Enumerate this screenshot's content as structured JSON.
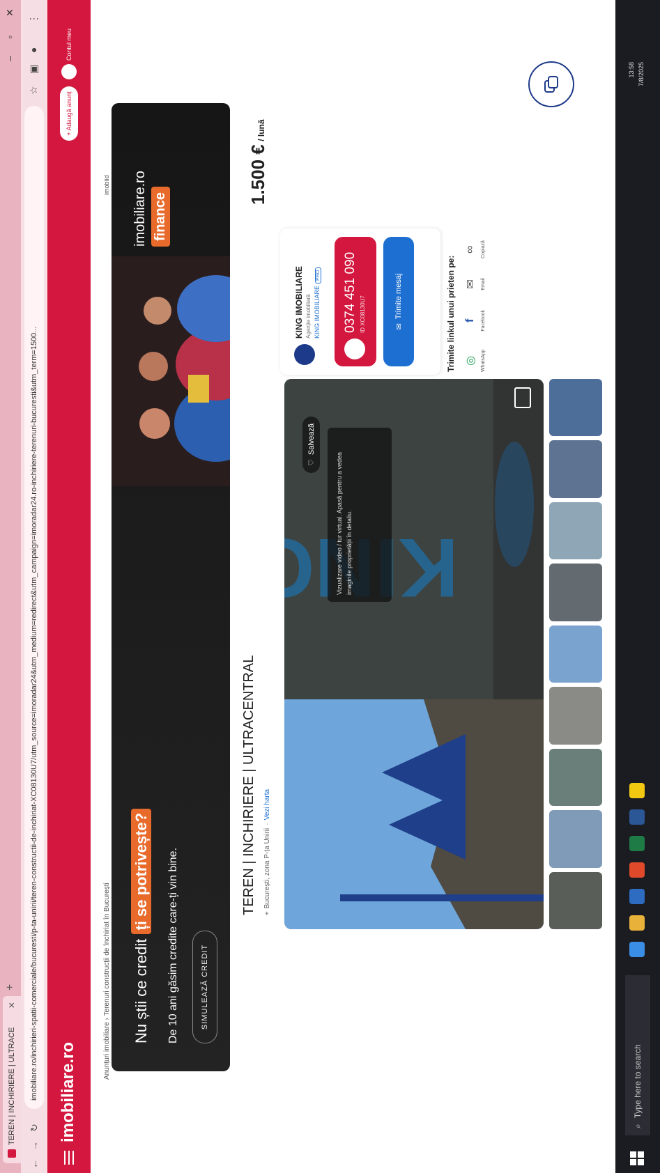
{
  "browser": {
    "tab_title": "TEREN | INCHIRIERE | ULTRACE",
    "new_tab": "+",
    "url": "imobiliare.ro/inchirieri-spatii-comerciale/bucuresti/p-ta-unirii/teren-constructii-de-inchiriat-XC08130U7/utm_source=imoradar24&utm_medium=redirect&utm_campaign=imoradar24.ro-inchiriere-terenuri-bucuresti&utm_term=1500..."
  },
  "site": {
    "brand": "imobiliare.ro",
    "header_button": "+ Adaugă anunț",
    "user_label": "Contul meu"
  },
  "breadcrumb": "Anunțuri imobiliare  ›  Terenuri construcții de închiriat în București",
  "listing_id": "imobiid",
  "banner": {
    "title_plain": "Nu știi ce credit ",
    "title_highlight": "ți se potrivește?",
    "subtitle": "De 10 ani găsim credite care-ți vin bine.",
    "button": "SIMULEAZĂ CREDIT",
    "logo_name": "imobiliare.ro",
    "logo_tag": "finance"
  },
  "listing": {
    "title": "TEREN | INCHIRIERE | ULTRACENTRAL",
    "location": "București, zona P-ța Unirii",
    "map_link": "Vezi harta",
    "price": "1.500 €",
    "price_unit": "/ lună"
  },
  "gallery": {
    "save_label": "Salvează",
    "tip_text": "Vizualizare video / tur virtual. Apasă pentru a vedea imaginile proprietății în detaliu."
  },
  "agent": {
    "name": "KING IMOBILIARE",
    "role": "Agenție imobiliară",
    "company": "KING IMOBILIARE",
    "badge": "PRO",
    "phone": "0374 451 090",
    "phone_sub": "ID XC08130U7",
    "message_button": "Trimite mesaj"
  },
  "share": {
    "title": "Trimite linkul unui prieten pe:",
    "items": [
      {
        "label": "WhatsApp",
        "icon": "whatsapp-icon"
      },
      {
        "label": "Facebook",
        "icon": "facebook-icon"
      },
      {
        "label": "Email",
        "icon": "email-icon"
      },
      {
        "label": "Copiază",
        "icon": "link-icon"
      }
    ]
  },
  "taskbar": {
    "search_placeholder": "Type here to search",
    "time": "13:58",
    "date": "7/8/2025"
  },
  "colors": {
    "brand_red": "#d4173e",
    "accent_blue": "#1d6fd1",
    "finance_orange": "#e86b2c"
  }
}
